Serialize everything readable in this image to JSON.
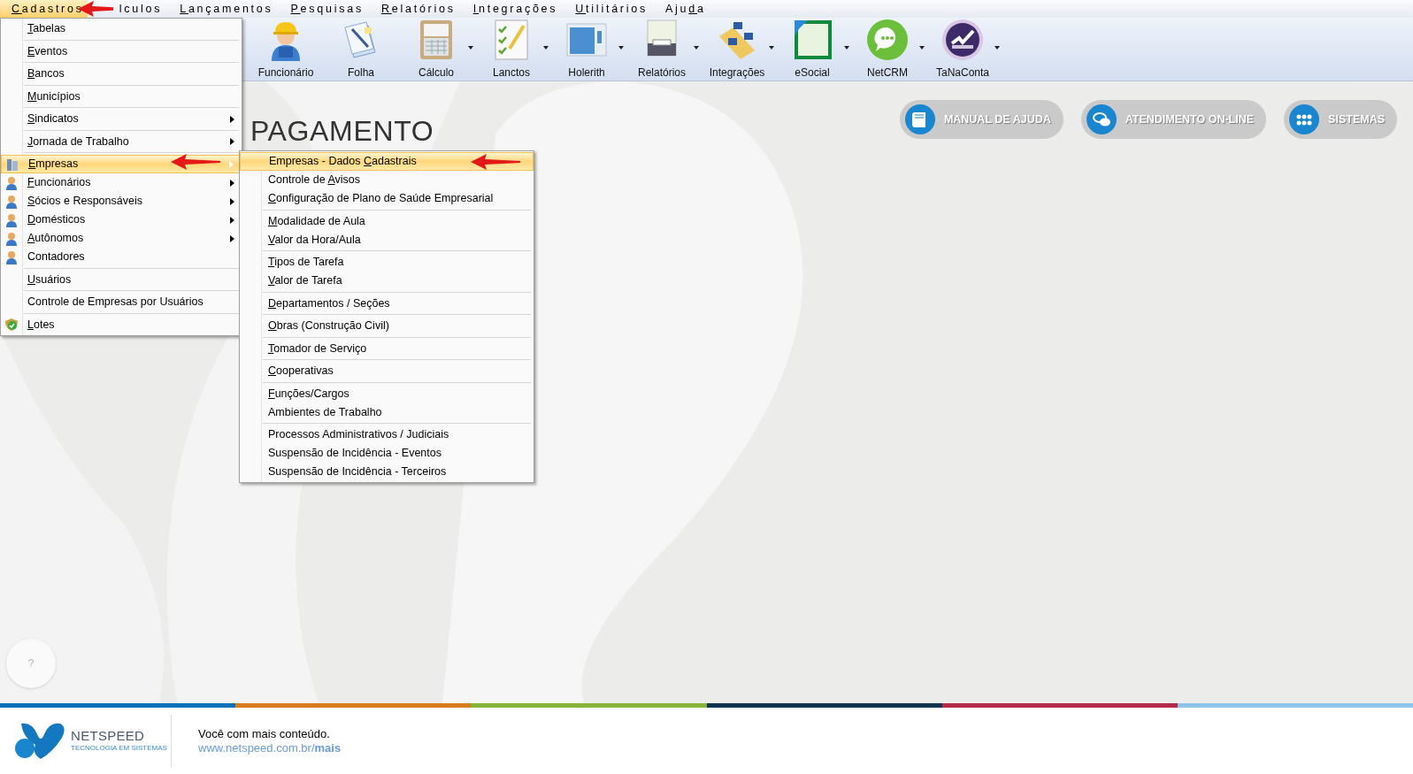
{
  "menubar": [
    {
      "key": "C",
      "rest": "adastros",
      "selected": true
    },
    {
      "label": "lculos",
      "selected": false
    },
    {
      "key": "L",
      "rest": "ançamentos",
      "selected": false
    },
    {
      "key": "P",
      "rest": "esquisas",
      "selected": false
    },
    {
      "key": "R",
      "rest": "elatórios",
      "selected": false
    },
    {
      "key": "I",
      "rest": "ntegrações",
      "selected": false
    },
    {
      "key": "U",
      "rest": "tilitários",
      "selected": false
    },
    {
      "before": "Aju",
      "key": "d",
      "rest": "a",
      "selected": false
    }
  ],
  "toolbar": [
    {
      "label": "Funcionário",
      "kind": "worker",
      "dropdown": false
    },
    {
      "label": "Folha",
      "kind": "sheet",
      "dropdown": false
    },
    {
      "label": "Cálculo",
      "kind": "calculator",
      "dropdown": true
    },
    {
      "label": "Lanctos",
      "kind": "checklist",
      "dropdown": true
    },
    {
      "label": "Holerith",
      "kind": "window",
      "dropdown": true
    },
    {
      "label": "Relatórios",
      "kind": "printer",
      "dropdown": true
    },
    {
      "label": "Integrações",
      "kind": "folder",
      "dropdown": true
    },
    {
      "label": "eSocial",
      "kind": "page",
      "dropdown": true
    },
    {
      "label": "NetCRM",
      "kind": "chat",
      "dropdown": true
    },
    {
      "label": "TaNaConta",
      "kind": "check",
      "dropdown": true
    }
  ],
  "heading": "PAGAMENTO",
  "cadastros_menu": [
    {
      "kind": "item",
      "key": "T",
      "rest": "abelas",
      "submenu": false,
      "selected": false
    },
    {
      "kind": "separator"
    },
    {
      "kind": "item",
      "key": "E",
      "rest": "ventos",
      "submenu": false,
      "selected": false
    },
    {
      "kind": "separator"
    },
    {
      "kind": "item",
      "key": "B",
      "rest": "ancos",
      "submenu": false,
      "selected": false
    },
    {
      "kind": "separator"
    },
    {
      "kind": "item",
      "key": "M",
      "rest": "unicípios",
      "submenu": false,
      "selected": false
    },
    {
      "kind": "separator"
    },
    {
      "kind": "item",
      "key": "S",
      "rest": "indicatos",
      "submenu": true,
      "selected": false
    },
    {
      "kind": "separator"
    },
    {
      "kind": "item",
      "key": "J",
      "rest": "ornada de Trabalho",
      "submenu": true,
      "selected": false
    },
    {
      "kind": "separator"
    },
    {
      "kind": "item",
      "key": "E",
      "rest": "mpresas",
      "submenu": true,
      "selected": true
    },
    {
      "kind": "item",
      "key": "F",
      "rest": "uncionários",
      "submenu": true,
      "selected": false
    },
    {
      "kind": "item",
      "key": "S",
      "rest": "ócios e Responsáveis",
      "submenu": true,
      "selected": false
    },
    {
      "kind": "item",
      "key": "D",
      "rest": "omésticos",
      "submenu": true,
      "selected": false
    },
    {
      "kind": "item",
      "key": "A",
      "rest": "utônomos",
      "submenu": true,
      "selected": false
    },
    {
      "kind": "item",
      "label": "Contadores",
      "submenu": false,
      "selected": false
    },
    {
      "kind": "separator"
    },
    {
      "kind": "item",
      "key": "U",
      "rest": "suários",
      "submenu": false,
      "selected": false
    },
    {
      "kind": "separator"
    },
    {
      "kind": "item",
      "label": "Controle de Empresas por Usuários",
      "submenu": false,
      "selected": false
    },
    {
      "kind": "separator"
    },
    {
      "kind": "item",
      "key": "L",
      "rest": "otes",
      "submenu": false,
      "selected": false
    }
  ],
  "empresas_submenu": [
    {
      "kind": "item",
      "before": "Empresas - Dados ",
      "key": "C",
      "rest": "adastrais",
      "selected": true
    },
    {
      "kind": "item",
      "before": "Controle de ",
      "key": "A",
      "rest": "visos",
      "selected": false
    },
    {
      "kind": "item",
      "key": "C",
      "rest": "onfiguração de Plano de Saúde Empresarial",
      "selected": false
    },
    {
      "kind": "separator"
    },
    {
      "kind": "item",
      "key": "M",
      "rest": "odalidade de Aula",
      "selected": false
    },
    {
      "kind": "item",
      "key": "V",
      "rest": "alor da Hora/Aula",
      "selected": false
    },
    {
      "kind": "separator"
    },
    {
      "kind": "item",
      "key": "T",
      "rest": "ipos de Tarefa",
      "selected": false
    },
    {
      "kind": "item",
      "key": "V",
      "rest": "alor de Tarefa",
      "selected": false
    },
    {
      "kind": "separator"
    },
    {
      "kind": "item",
      "key": "D",
      "rest": "epartamentos / Seções",
      "selected": false
    },
    {
      "kind": "separator"
    },
    {
      "kind": "item",
      "key": "O",
      "rest": "bras (Construção Civil)",
      "selected": false
    },
    {
      "kind": "separator"
    },
    {
      "kind": "item",
      "key": "T",
      "rest": "omador de Serviço",
      "selected": false
    },
    {
      "kind": "separator"
    },
    {
      "kind": "item",
      "key": "C",
      "rest": "ooperativas",
      "selected": false
    },
    {
      "kind": "separator"
    },
    {
      "kind": "item",
      "key": "F",
      "rest": "unções/Cargos",
      "selected": false
    },
    {
      "kind": "item",
      "label": "Ambientes de Trabalho",
      "selected": false
    },
    {
      "kind": "separator"
    },
    {
      "kind": "item",
      "label": "Processos Administrativos / Judiciais",
      "selected": false
    },
    {
      "kind": "item",
      "label": "Suspensão de Incidência - Eventos",
      "selected": false
    },
    {
      "kind": "item",
      "label": "Suspensão de Incidência - Terceiros",
      "selected": false
    }
  ],
  "quick_buttons": [
    {
      "label": "MANUAL DE AJUDA",
      "kind": "book"
    },
    {
      "label": "ATENDIMENTO ON-LINE",
      "kind": "chat"
    },
    {
      "label": "SISTEMAS",
      "kind": "grid"
    }
  ],
  "help_button": "?",
  "footer": {
    "brand": "NETSPEED",
    "tagline": "TECNOLOGIA EM SISTEMAS",
    "message": "Você com mais conteúdo.",
    "link": "www.netspeed.com.br/**mais**"
  }
}
